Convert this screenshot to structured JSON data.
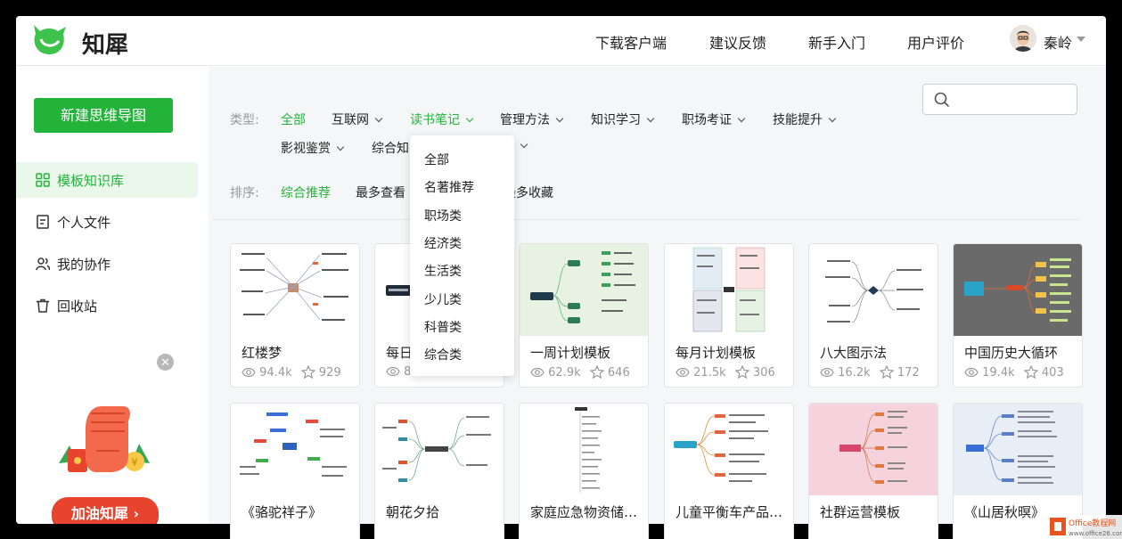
{
  "header": {
    "brand": "知犀",
    "nav": [
      "下载客户端",
      "建议反馈",
      "新手入门",
      "用户评价"
    ],
    "username": "秦岭"
  },
  "sidebar": {
    "new_button": "新建思维导图",
    "items": [
      {
        "label": "模板知识库",
        "icon": "grid-icon",
        "active": true
      },
      {
        "label": "个人文件",
        "icon": "file-icon",
        "active": false
      },
      {
        "label": "我的协作",
        "icon": "users-icon",
        "active": false
      },
      {
        "label": "回收站",
        "icon": "trash-icon",
        "active": false
      }
    ],
    "promo_label": "加油知犀 ›"
  },
  "filters": {
    "type_label": "类型:",
    "types": [
      "全部",
      "互联网",
      "读书笔记",
      "管理方法",
      "知识学习",
      "职场考证",
      "技能提升",
      "影视鉴赏",
      "综合知"
    ],
    "sort_label": "排序:",
    "sorts": [
      "综合推荐",
      "最多查看",
      "最多收藏"
    ],
    "search_placeholder": ""
  },
  "dropdown": {
    "items": [
      "全部",
      "名著推荐",
      "职场类",
      "经济类",
      "生活类",
      "少儿类",
      "科普类",
      "综合类"
    ]
  },
  "cards": [
    {
      "title": "红楼梦",
      "views": "94.4k",
      "stars": "929"
    },
    {
      "title": "每日",
      "views": "8",
      "stars": ""
    },
    {
      "title": "一周计划模板",
      "views": "62.9k",
      "stars": "646"
    },
    {
      "title": "每月计划模板",
      "views": "21.5k",
      "stars": "306"
    },
    {
      "title": "八大图示法",
      "views": "16.2k",
      "stars": "172"
    },
    {
      "title": "中国历史大循环",
      "views": "19.4k",
      "stars": "403"
    },
    {
      "title": "《骆驼祥子》",
      "views": "",
      "stars": ""
    },
    {
      "title": "朝花夕拾",
      "views": "",
      "stars": ""
    },
    {
      "title": "家庭应急物资储…",
      "views": "",
      "stars": ""
    },
    {
      "title": "儿童平衡车产品…",
      "views": "",
      "stars": ""
    },
    {
      "title": "社群运营模板",
      "views": "",
      "stars": ""
    },
    {
      "title": "《山居秋暝》",
      "views": "",
      "stars": ""
    }
  ],
  "watermark": {
    "line1": "Office教程网",
    "line2": "www.office26.com"
  },
  "colors": {
    "accent": "#23b33a",
    "promo": "#e8432c"
  }
}
